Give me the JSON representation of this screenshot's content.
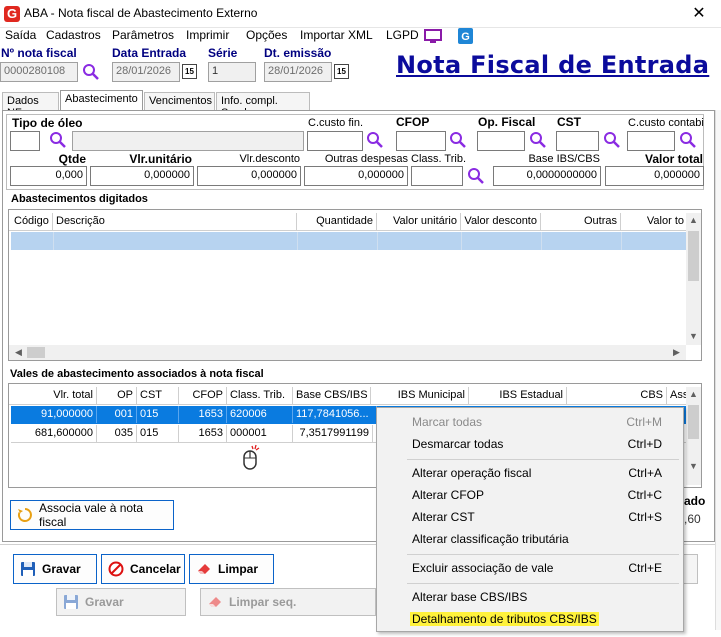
{
  "window": {
    "title": "ABA - Nota fiscal de Abastecimento Externo",
    "app_icon_letter": "G",
    "close_glyph": "✕"
  },
  "menu": {
    "items": [
      "Saída",
      "Cadastros",
      "Parâmetros",
      "Imprimir",
      "Opções",
      "Importar XML",
      "LGPD"
    ]
  },
  "header": {
    "nota_label": "Nº nota fiscal",
    "nota_value": "0000280108",
    "data_entrada_label": "Data Entrada",
    "data_entrada_value": "28/01/2026",
    "serie_label": "Série",
    "serie_value": "1",
    "dt_emissao_label": "Dt. emissão",
    "dt_emissao_value": "28/01/2026",
    "cal_label": "15",
    "big_title": "Nota Fiscal de Entrada"
  },
  "tabs": [
    "Dados NF",
    "Abastecimento",
    "Vencimentos",
    "Info. compl. Sped"
  ],
  "oleo": {
    "tipo_label": "Tipo de óleo",
    "ccusto_fin_label": "C.custo fin.",
    "cfop_label": "CFOP",
    "op_fiscal_label": "Op. Fiscal",
    "cst_label": "CST",
    "ccusto_contabil_label": "C.custo contabil",
    "qtde_label": "Qtde",
    "qtde_value": "0,000",
    "vlr_unitario_label": "Vlr.unitário",
    "vlr_unitario_value": "0,000000",
    "vlr_desconto_label": "Vlr.desconto",
    "vlr_desconto_value": "0,000000",
    "outras_label": "Outras despesas",
    "outras_value": "0,000000",
    "class_trib_label": "Class. Trib.",
    "base_ibs_label": "Base IBS/CBS",
    "base_ibs_value": "0,0000000000",
    "valor_total_label": "Valor total",
    "valor_total_value": "0,000000"
  },
  "abastecimentos": {
    "title": "Abastecimentos digitados",
    "columns": [
      "Código",
      "Descrição",
      "Quantidade",
      "Valor unitário",
      "Valor desconto",
      "Outras",
      "Valor to"
    ]
  },
  "vales": {
    "title": "Vales de abastecimento associados à nota fiscal",
    "columns": [
      "Vlr. total",
      "OP",
      "CST",
      "CFOP",
      "Class. Trib.",
      "Base CBS/IBS",
      "IBS Municipal",
      "IBS Estadual",
      "CBS",
      "Ass"
    ],
    "rows": [
      [
        "91,000000",
        "001",
        "015",
        "1653",
        "620006",
        "117,7841056..."
      ],
      [
        "681,600000",
        "035",
        "015",
        "1653",
        "000001",
        "7,3517991199"
      ]
    ],
    "associa_button": "Associa vale à nota fiscal"
  },
  "side_fragments": {
    "ado": "ado",
    "value": ",60"
  },
  "buttons": {
    "gravar": "Gravar",
    "cancelar": "Cancelar",
    "limpar": "Limpar",
    "gravar2": "Gravar",
    "limpar_seq": "Limpar seq."
  },
  "context_menu": {
    "items": [
      {
        "label": "Marcar todas",
        "shortcut": "Ctrl+M"
      },
      {
        "label": "Desmarcar todas",
        "shortcut": "Ctrl+D"
      },
      {
        "label": "Alterar operação fiscal",
        "shortcut": "Ctrl+A"
      },
      {
        "label": "Alterar CFOP",
        "shortcut": "Ctrl+C"
      },
      {
        "label": "Alterar CST",
        "shortcut": "Ctrl+S"
      },
      {
        "label": "Alterar classificação tributária",
        "shortcut": ""
      },
      {
        "label": "Excluir associação de vale",
        "shortcut": "Ctrl+E"
      },
      {
        "label": "Alterar base CBS/IBS",
        "shortcut": ""
      },
      {
        "label": "Detalhamento de tributos CBS/IBS",
        "shortcut": ""
      }
    ]
  },
  "colors": {
    "accent": "#0b63c9",
    "title_blue": "#0b0b9c",
    "label_blue": "#000080",
    "selection": "#0a7be0",
    "highlight": "#fff23c"
  },
  "icons": [
    "search-icon",
    "calendar-icon",
    "monitor-icon",
    "app-logo-icon",
    "floppy-disk-icon",
    "cancel-icon",
    "eraser-icon",
    "refresh-icon",
    "mouse-cursor-icon"
  ]
}
